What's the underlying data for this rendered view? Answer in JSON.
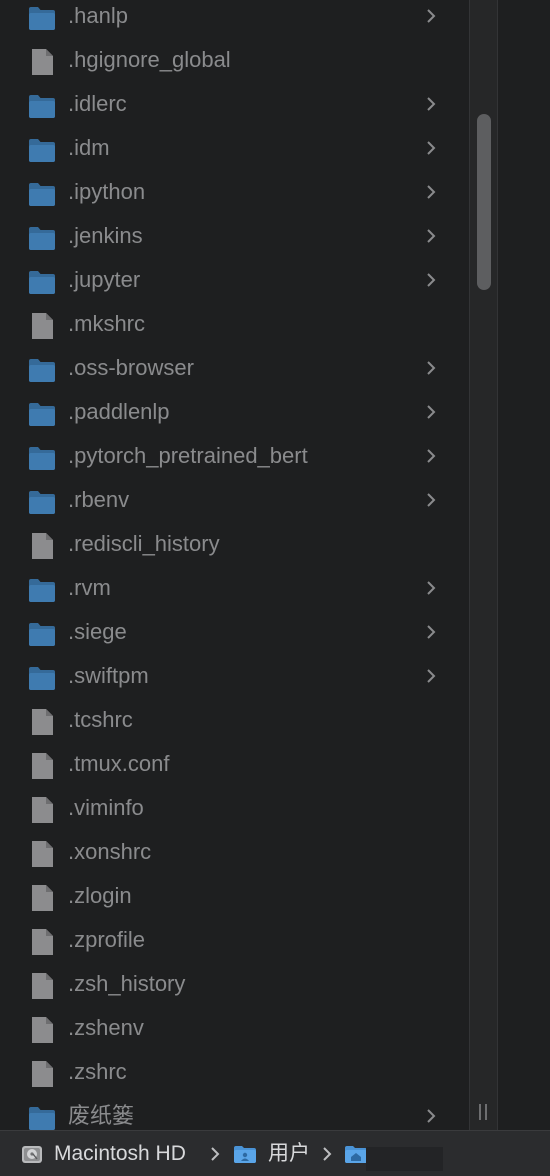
{
  "files": [
    {
      "name": ".hanlp",
      "kind": "folder",
      "icon": "folder-icon"
    },
    {
      "name": ".hgignore_global",
      "kind": "file",
      "icon": "document-icon"
    },
    {
      "name": ".idlerc",
      "kind": "folder",
      "icon": "folder-icon"
    },
    {
      "name": ".idm",
      "kind": "folder",
      "icon": "folder-icon"
    },
    {
      "name": ".ipython",
      "kind": "folder",
      "icon": "folder-icon"
    },
    {
      "name": ".jenkins",
      "kind": "folder",
      "icon": "folder-icon"
    },
    {
      "name": ".jupyter",
      "kind": "folder",
      "icon": "folder-icon"
    },
    {
      "name": ".mkshrc",
      "kind": "file",
      "icon": "document-icon"
    },
    {
      "name": ".oss-browser",
      "kind": "folder",
      "icon": "folder-icon"
    },
    {
      "name": ".paddlenlp",
      "kind": "folder",
      "icon": "folder-icon"
    },
    {
      "name": ".pytorch_pretrained_bert",
      "kind": "folder",
      "icon": "folder-icon"
    },
    {
      "name": ".rbenv",
      "kind": "folder",
      "icon": "folder-icon"
    },
    {
      "name": ".rediscli_history",
      "kind": "file",
      "icon": "document-icon"
    },
    {
      "name": ".rvm",
      "kind": "folder",
      "icon": "folder-icon"
    },
    {
      "name": ".siege",
      "kind": "folder",
      "icon": "folder-icon"
    },
    {
      "name": ".swiftpm",
      "kind": "folder",
      "icon": "folder-icon"
    },
    {
      "name": ".tcshrc",
      "kind": "file",
      "icon": "document-icon"
    },
    {
      "name": ".tmux.conf",
      "kind": "file",
      "icon": "document-icon"
    },
    {
      "name": ".viminfo",
      "kind": "file",
      "icon": "document-icon"
    },
    {
      "name": ".xonshrc",
      "kind": "file",
      "icon": "document-icon"
    },
    {
      "name": ".zlogin",
      "kind": "file",
      "icon": "document-icon"
    },
    {
      "name": ".zprofile",
      "kind": "file",
      "icon": "document-icon"
    },
    {
      "name": ".zsh_history",
      "kind": "file",
      "icon": "document-icon"
    },
    {
      "name": ".zshenv",
      "kind": "file",
      "icon": "document-icon"
    },
    {
      "name": ".zshrc",
      "kind": "file",
      "icon": "document-icon"
    },
    {
      "name": "废纸篓",
      "kind": "folder",
      "icon": "folder-icon"
    }
  ],
  "pathbar": {
    "items": [
      {
        "label": "Macintosh HD",
        "icon": "hard-drive-icon"
      },
      {
        "label": "用户",
        "icon": "users-folder-icon"
      },
      {
        "label": "",
        "icon": "home-folder-icon"
      }
    ]
  },
  "colors": {
    "background": "#1e1f20",
    "folder": "#3f7bb0",
    "folder_tab": "#356a99",
    "document": "#8c8c8e",
    "text": "#8a8b8d",
    "chevron": "#8a8b8d",
    "pathbar_bg": "#2b2c2e",
    "pathbar_text": "#d8d9db",
    "pathbar_folder": "#5aa5e8"
  }
}
